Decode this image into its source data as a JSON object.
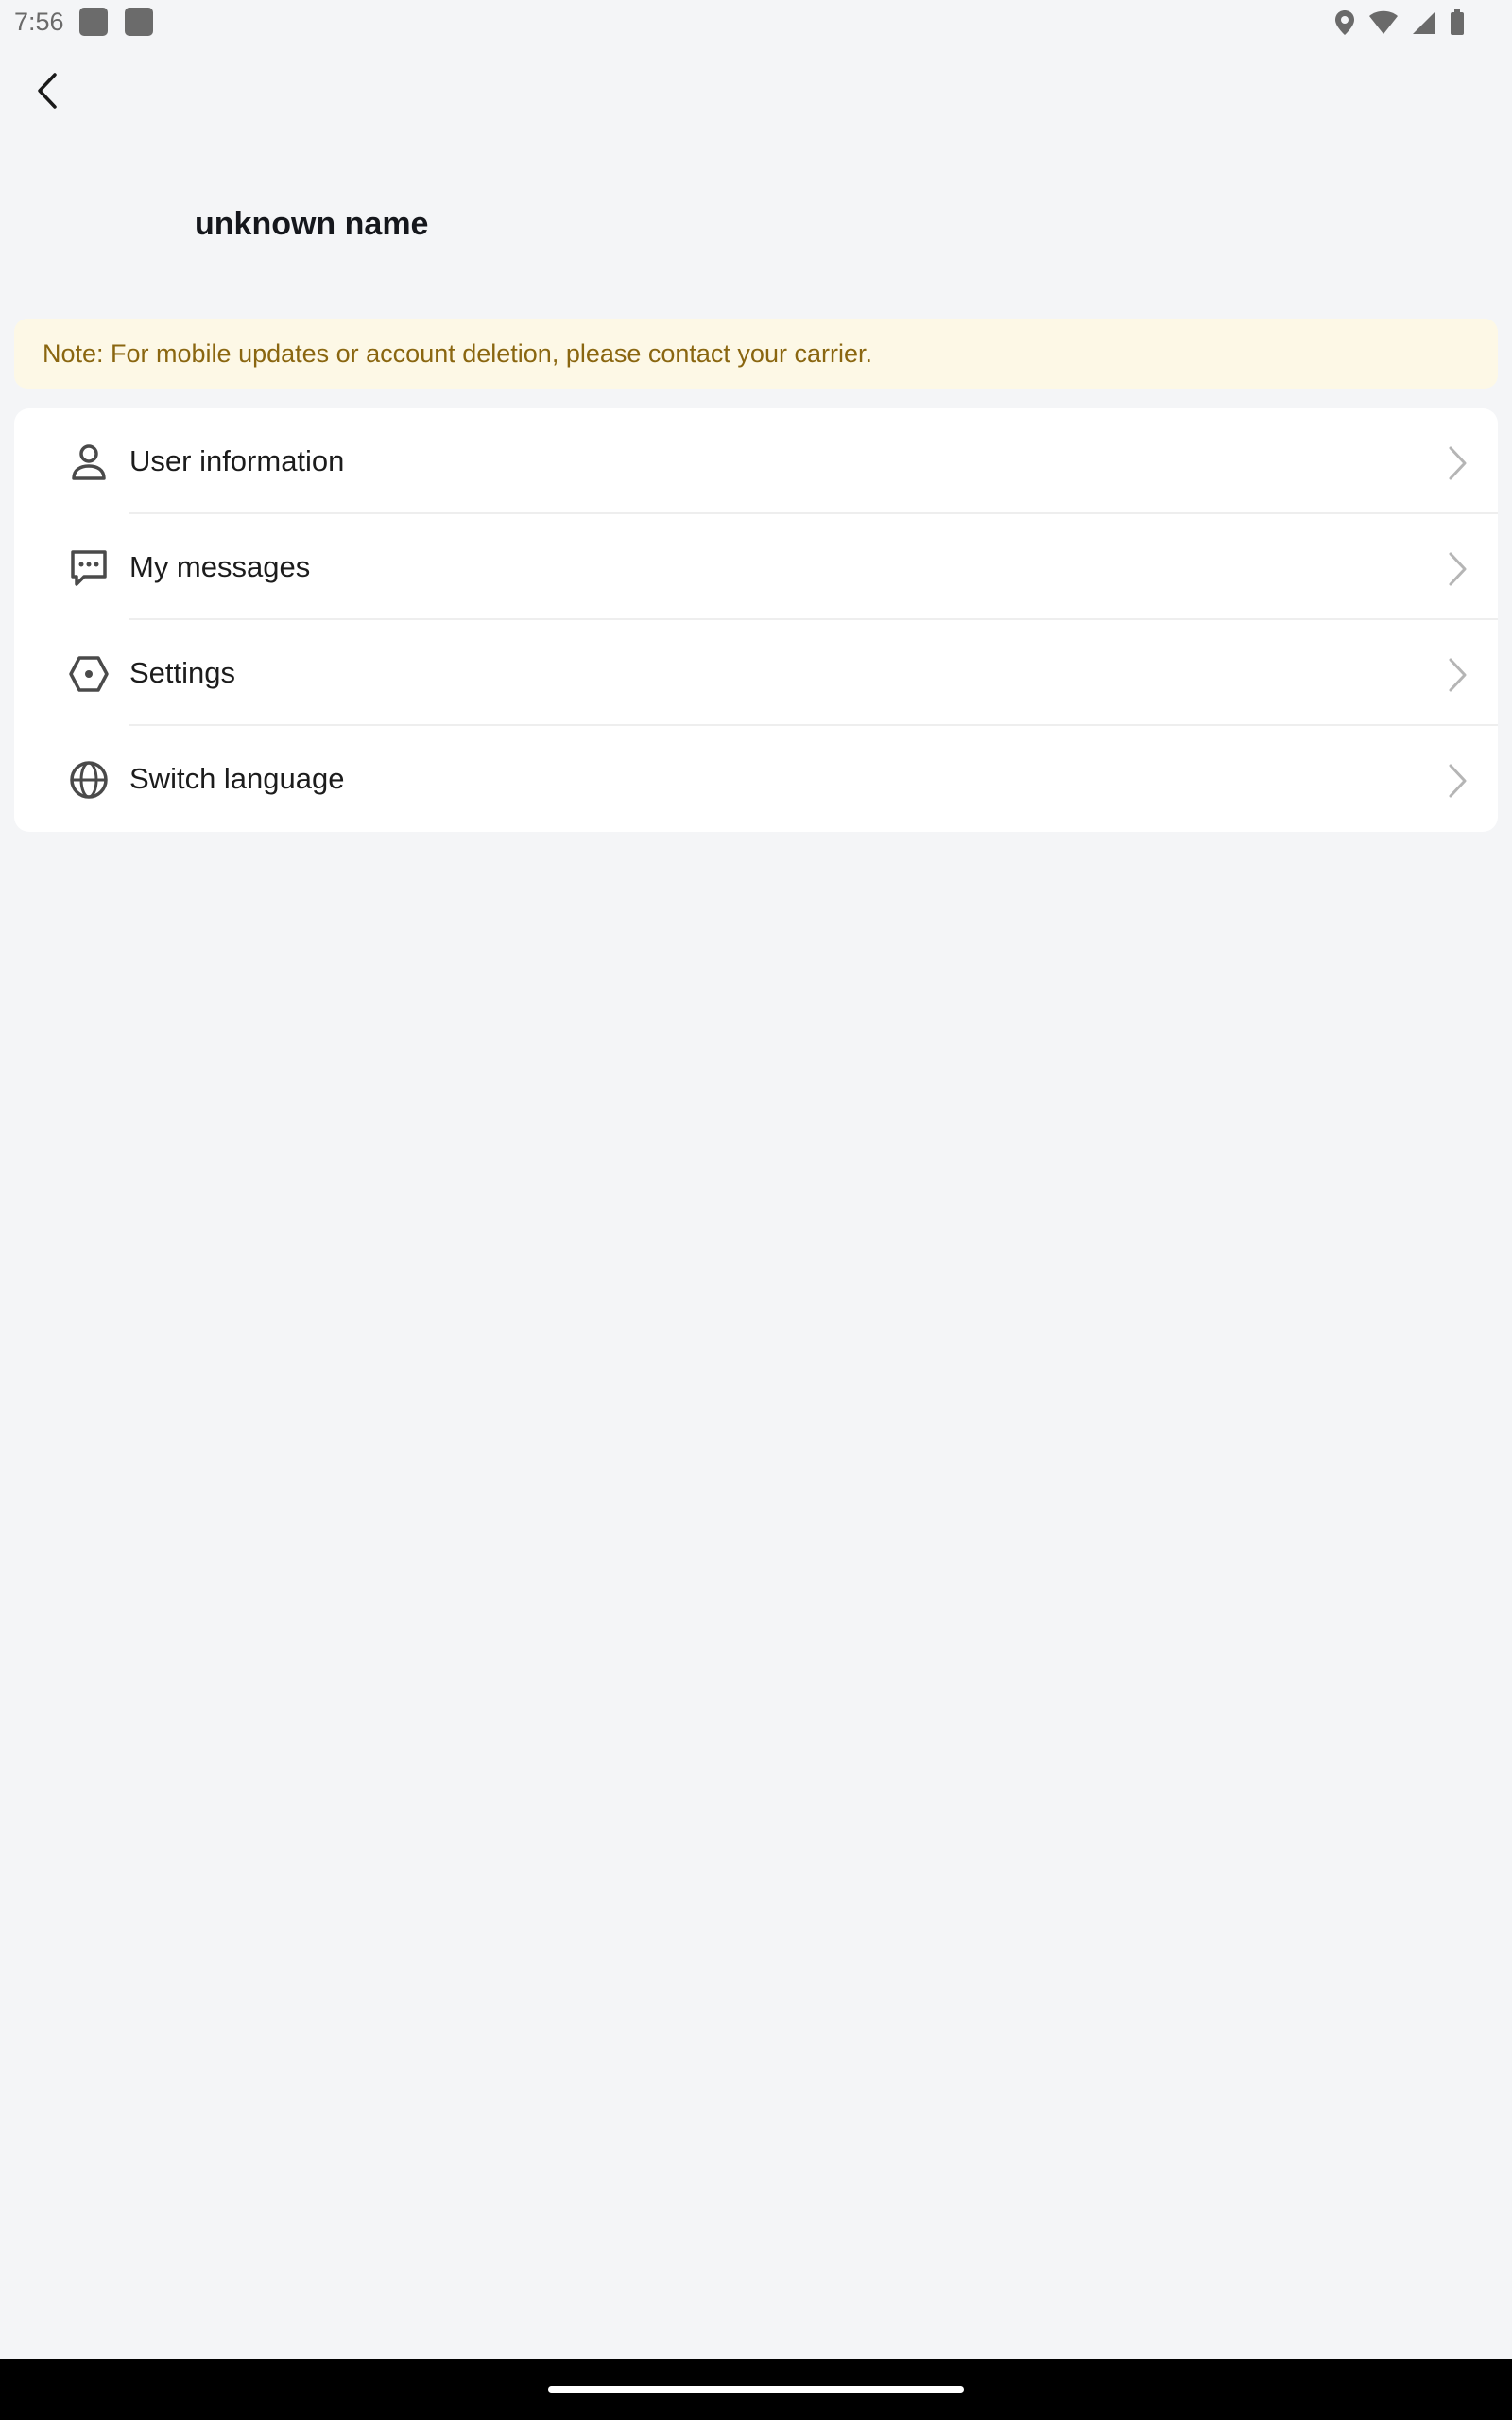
{
  "status_bar": {
    "time": "7:56",
    "icons": [
      "app-notification-icon",
      "app-notification-icon",
      "location-icon",
      "wifi-icon",
      "signal-icon",
      "battery-icon"
    ]
  },
  "header": {
    "back_icon": "chevron-left-icon"
  },
  "profile": {
    "name": "unknown name"
  },
  "notice": {
    "text": "Note: For mobile updates or account deletion, please contact your carrier.",
    "background_color": "#fdf8e6",
    "text_color": "#8a6610"
  },
  "menu": {
    "items": [
      {
        "label": "User information",
        "icon": "person-icon"
      },
      {
        "label": "My messages",
        "icon": "message-icon"
      },
      {
        "label": "Settings",
        "icon": "settings-hexagon-icon"
      },
      {
        "label": "Switch language",
        "icon": "globe-icon"
      }
    ],
    "chevron_icon": "chevron-right-icon"
  }
}
